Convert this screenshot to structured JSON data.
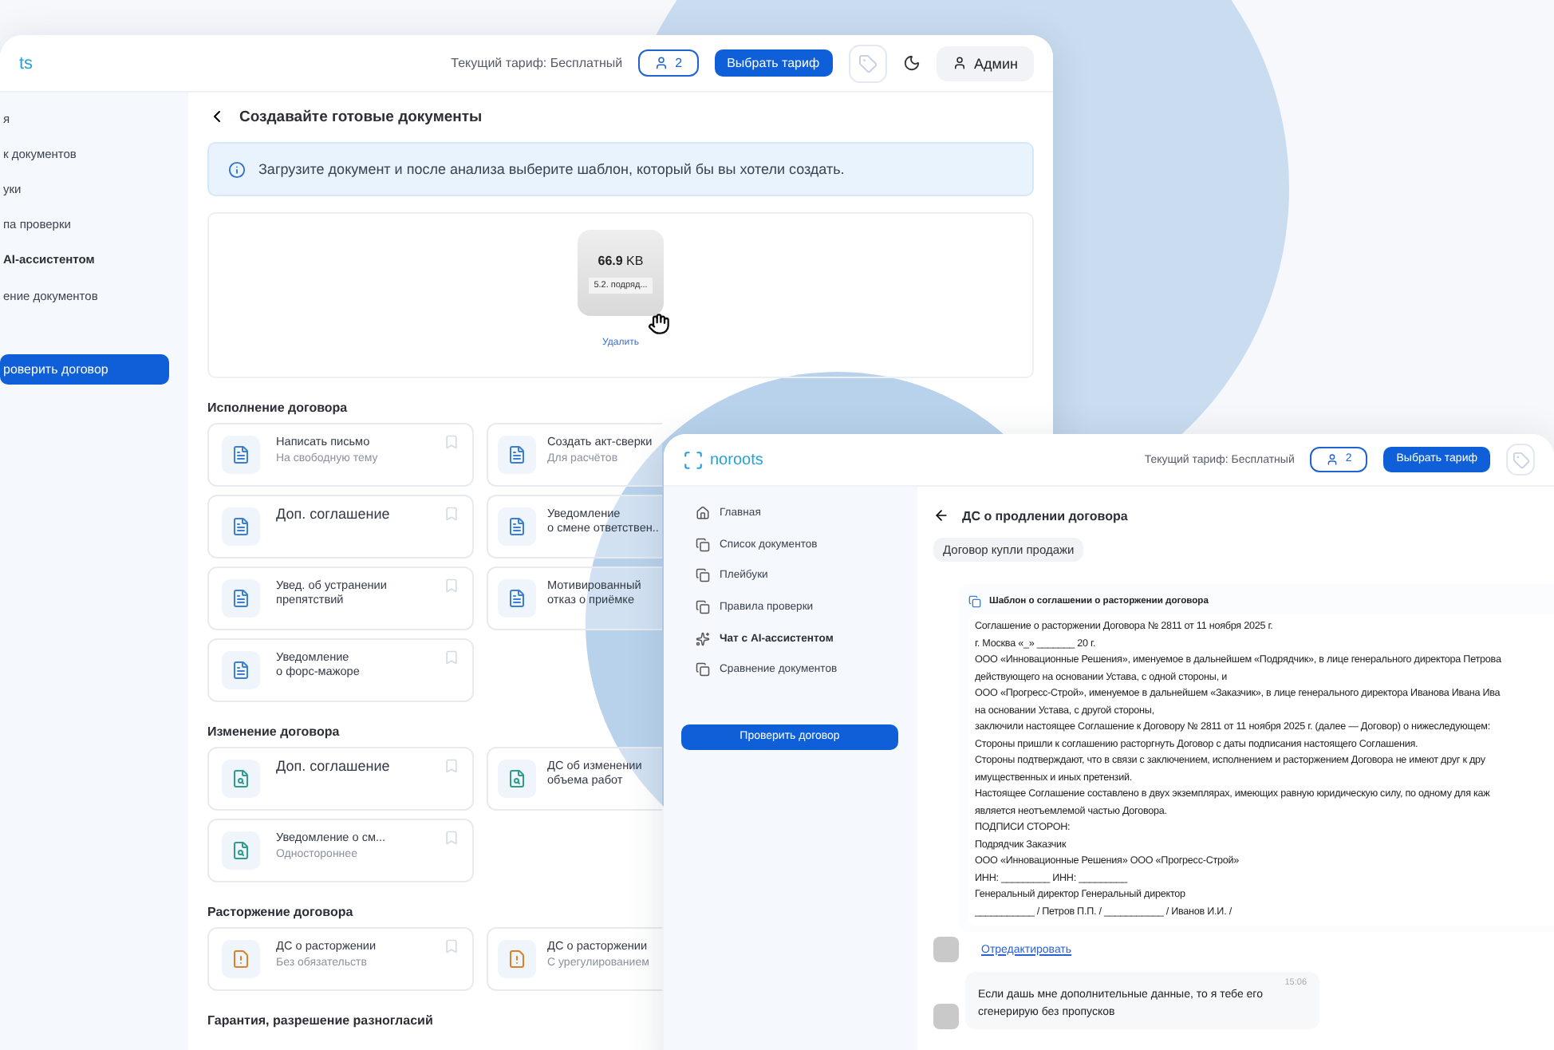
{
  "back_window": {
    "logo": "ts",
    "tariff_label": "Текущий тариф: Бесплатный",
    "users_count": "2",
    "choose_tariff_button": "Выбрать тариф",
    "admin_button": "Админ",
    "sidebar": {
      "items": [
        {
          "label": "я",
          "selected": false
        },
        {
          "label": "к документов",
          "selected": false
        },
        {
          "label": "уки",
          "selected": false
        },
        {
          "label": "па проверки",
          "selected": false
        },
        {
          "label": "AI-ассистентом",
          "selected": true
        },
        {
          "label": "ение документов",
          "selected": false
        }
      ],
      "check_button": "роверить договор"
    },
    "page_title": "Создавайте готовые документы",
    "info_banner": "Загрузите документ и после анализа выберите шаблон, который бы вы хотели создать.",
    "upload": {
      "size": "**66.9** KB",
      "file_name": "5.2. подряд...",
      "delete_link": "Удалить"
    },
    "sections": [
      {
        "title": "Исполнение договора",
        "cards": [
          {
            "kind": "doc",
            "title": "Написать письмо",
            "subtitle": "На свободную тему"
          },
          {
            "kind": "doc",
            "title": "Создать акт-сверки",
            "subtitle": "Для расчётов"
          },
          {
            "kind": "doc",
            "title": "Доп. соглашение"
          },
          {
            "kind": "doc",
            "title": "Уведомление\nо смене ответствен.."
          },
          {
            "kind": "doc",
            "title": "Увед. об устранении\nпрепятствий"
          },
          {
            "kind": "doc",
            "title": "Мотивированный\nотказ о приёмке"
          },
          {
            "kind": "doc",
            "title": "Уведомление\nо форс-мажоре"
          }
        ]
      },
      {
        "title": "Изменение договора",
        "cards": [
          {
            "kind": "edit",
            "title": "Доп. соглашение"
          },
          {
            "kind": "edit",
            "title": "ДС об изменении\nобъема работ"
          },
          {
            "kind": "edit",
            "title": "Уведомление о см...",
            "subtitle": "Одностороннее"
          }
        ]
      },
      {
        "title": "Расторжение договора",
        "cards": [
          {
            "kind": "terminate",
            "title": "ДС о расторжении",
            "subtitle": "Без обязательств"
          },
          {
            "kind": "terminate",
            "title": "ДС о расторжении",
            "subtitle": "С урегулированием"
          }
        ]
      },
      {
        "title": "Гарантия, разрешение разногласий"
      }
    ]
  },
  "front_window": {
    "logo": "noroots",
    "tariff_label": "Текущий тариф: Бесплатный",
    "users_count": "2",
    "choose_tariff_button": "Выбрать тариф",
    "sidebar": {
      "items": [
        {
          "label": "Главная",
          "selected": false
        },
        {
          "label": "Список документов",
          "selected": false
        },
        {
          "label": "Плейбуки",
          "selected": false
        },
        {
          "label": "Правила проверки",
          "selected": false
        },
        {
          "label": "Чат с AI-ассистентом",
          "selected": true
        },
        {
          "label": "Сравнение документов",
          "selected": false
        }
      ],
      "check_button": "Проверить договор"
    },
    "page_title": "ДС о продлении договора",
    "tag": "Договор купли продажи",
    "template": {
      "title": "Шаблон о соглашении о расторжении договора",
      "lines": [
        "Соглашение о расторжении Договора № 2811 от 11 ноября 2025 г.",
        "г. Москва «_» _______ 20 г.",
        "ООО «Инновационные Решения», именуемое в дальнейшем «Подрядчик», в лице генерального директора Петрова",
        "действующего на основании Устава, с одной стороны, и",
        "ООО «Прогресс-Строй», именуемое в дальнейшем «Заказчик», в лице генерального директора Иванова Ивана Ива",
        "на основании Устава, с другой стороны,",
        "заключили настоящее Соглашение к Договору № 2811 от 11 ноября 2025 г. (далее — Договор) о нижеследующем:",
        "Стороны пришли к соглашению расторгнуть Договор с даты подписания настоящего Соглашения.",
        "Стороны подтверждают, что в связи с заключением, исполнением и расторжением Договора не имеют друг к дру",
        "имущественных и иных претензий.",
        "Настоящее Соглашение составлено в двух экземплярах, имеющих равную юридическую силу, по одному для каж",
        "является неотъемлемой частью Договора.",
        "ПОДПИСИ СТОРОН:",
        "Подрядчик Заказчик",
        "ООО «Инновационные Решения» ООО «Прогресс-Строй»",
        "ИНН: _________ ИНН: _________",
        "Генеральный директор Генеральный директор",
        "___________ / Петров П.П. / ___________ / Иванов И.И. /"
      ]
    },
    "edit_link": "Отредактировать",
    "message": {
      "time": "15:06",
      "text": "Если дашь мне дополнительные данные, то я тебе его сгенерирую без пропусков"
    }
  }
}
